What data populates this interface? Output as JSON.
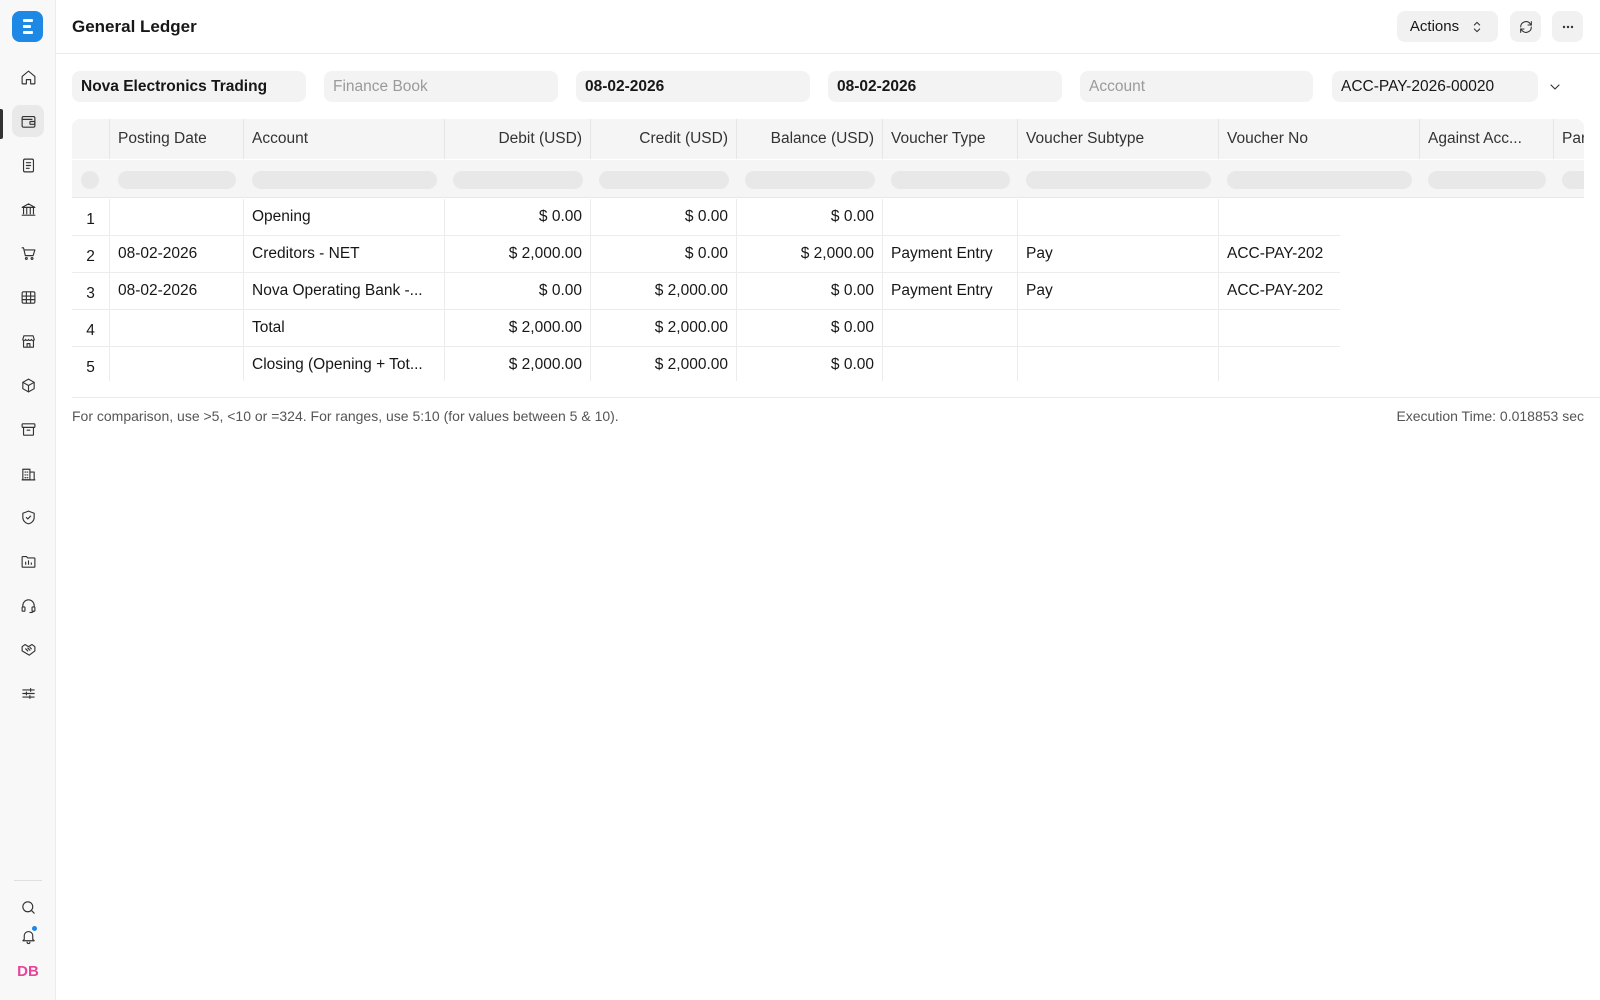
{
  "app": {
    "logo_icon": "erp-logo-icon",
    "accent": "#1e88e5"
  },
  "sidebar": {
    "items": [
      {
        "name": "home",
        "icon": "home-icon"
      },
      {
        "name": "accounting",
        "icon": "wallet-icon",
        "active": true
      },
      {
        "name": "invoices",
        "icon": "document-icon"
      },
      {
        "name": "banking",
        "icon": "bank-icon"
      },
      {
        "name": "buying",
        "icon": "cart-icon"
      },
      {
        "name": "reports",
        "icon": "table-icon"
      },
      {
        "name": "selling",
        "icon": "store-icon"
      },
      {
        "name": "stock",
        "icon": "box-icon"
      },
      {
        "name": "assets",
        "icon": "archive-icon"
      },
      {
        "name": "organization",
        "icon": "building-icon"
      },
      {
        "name": "quality",
        "icon": "shield-icon"
      },
      {
        "name": "projects",
        "icon": "folder-chart-icon"
      },
      {
        "name": "support",
        "icon": "headset-icon"
      },
      {
        "name": "crm",
        "icon": "handshake-icon"
      },
      {
        "name": "settings",
        "icon": "sliders-icon"
      }
    ],
    "bottom": {
      "search_icon": "search-icon",
      "notification_icon": "bell-icon",
      "avatar_initials": "DB",
      "avatar_color": "#e8449a"
    }
  },
  "header": {
    "title": "General Ledger",
    "actions_label": "Actions"
  },
  "filters": {
    "company": "Nova Electronics Trading",
    "finance_book_placeholder": "Finance Book",
    "from_date": "08-02-2026",
    "to_date": "08-02-2026",
    "account_placeholder": "Account",
    "voucher_no": "ACC-PAY-2026-00020"
  },
  "table": {
    "columns": {
      "posting_date": "Posting Date",
      "account": "Account",
      "debit": "Debit (USD)",
      "credit": "Credit (USD)",
      "balance": "Balance (USD)",
      "voucher_type": "Voucher Type",
      "voucher_subtype": "Voucher Subtype",
      "voucher_no": "Voucher No",
      "against_account": "Against Acc...",
      "party": "Par"
    },
    "rows": [
      {
        "idx": "1",
        "posting_date": "",
        "account": "Opening",
        "debit": "$ 0.00",
        "credit": "$ 0.00",
        "balance": "$ 0.00",
        "voucher_type": "",
        "voucher_subtype": "",
        "voucher_no": ""
      },
      {
        "idx": "2",
        "posting_date": "08-02-2026",
        "account": "Creditors - NET",
        "debit": "$ 2,000.00",
        "credit": "$ 0.00",
        "balance": "$ 2,000.00",
        "voucher_type": "Payment Entry",
        "voucher_subtype": "Pay",
        "voucher_no": "ACC-PAY-202"
      },
      {
        "idx": "3",
        "posting_date": "08-02-2026",
        "account": "Nova Operating Bank -...",
        "debit": "$ 0.00",
        "credit": "$ 2,000.00",
        "balance": "$ 0.00",
        "voucher_type": "Payment Entry",
        "voucher_subtype": "Pay",
        "voucher_no": "ACC-PAY-202"
      },
      {
        "idx": "4",
        "posting_date": "",
        "account": "Total",
        "debit": "$ 2,000.00",
        "credit": "$ 2,000.00",
        "balance": "$ 0.00",
        "voucher_type": "",
        "voucher_subtype": "",
        "voucher_no": ""
      },
      {
        "idx": "5",
        "posting_date": "",
        "account": "Closing (Opening + Tot...",
        "debit": "$ 2,000.00",
        "credit": "$ 2,000.00",
        "balance": "$ 0.00",
        "voucher_type": "",
        "voucher_subtype": "",
        "voucher_no": ""
      }
    ]
  },
  "footer": {
    "hint": "For comparison, use >5, <10 or =324. For ranges, use 5:10 (for values between 5 & 10).",
    "execution_time": "Execution Time: 0.018853 sec"
  }
}
